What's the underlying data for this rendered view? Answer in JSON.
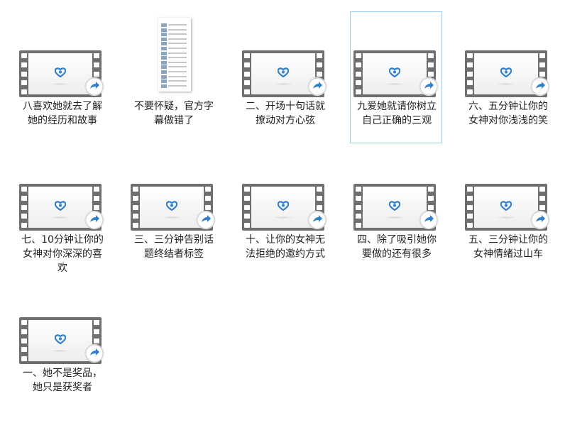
{
  "files": [
    {
      "name": "八喜欢她就去了解她的经历和故事",
      "type": "video",
      "selected": false
    },
    {
      "name": "不要怀疑，官方字幕做错了",
      "type": "document",
      "selected": false
    },
    {
      "name": "二、开场十句话就撩动对方心弦",
      "type": "video",
      "selected": false
    },
    {
      "name": "九爱她就请你树立自己正确的三观",
      "type": "video",
      "selected": true
    },
    {
      "name": "六、五分钟让你的女神对你浅浅的笑",
      "type": "video",
      "selected": false
    },
    {
      "name": "七、10分钟让你的女神对你深深的喜欢",
      "type": "video",
      "selected": false
    },
    {
      "name": "三、三分钟告别话题终结者标签",
      "type": "video",
      "selected": false
    },
    {
      "name": "十、让你的女神无法拒绝的邀约方式",
      "type": "video",
      "selected": false
    },
    {
      "name": "四、除了吸引她你要做的还有很多",
      "type": "video",
      "selected": false
    },
    {
      "name": "五、三分钟让你的女神情绪过山车",
      "type": "video",
      "selected": false
    },
    {
      "name": "一、她不是奖品，她只是获奖者",
      "type": "video",
      "selected": false
    }
  ],
  "colors": {
    "selection_border": "#99d1ec",
    "film": "#6f6f6f",
    "logo": "#2f7fd0",
    "badge": "#2f7fd0"
  }
}
